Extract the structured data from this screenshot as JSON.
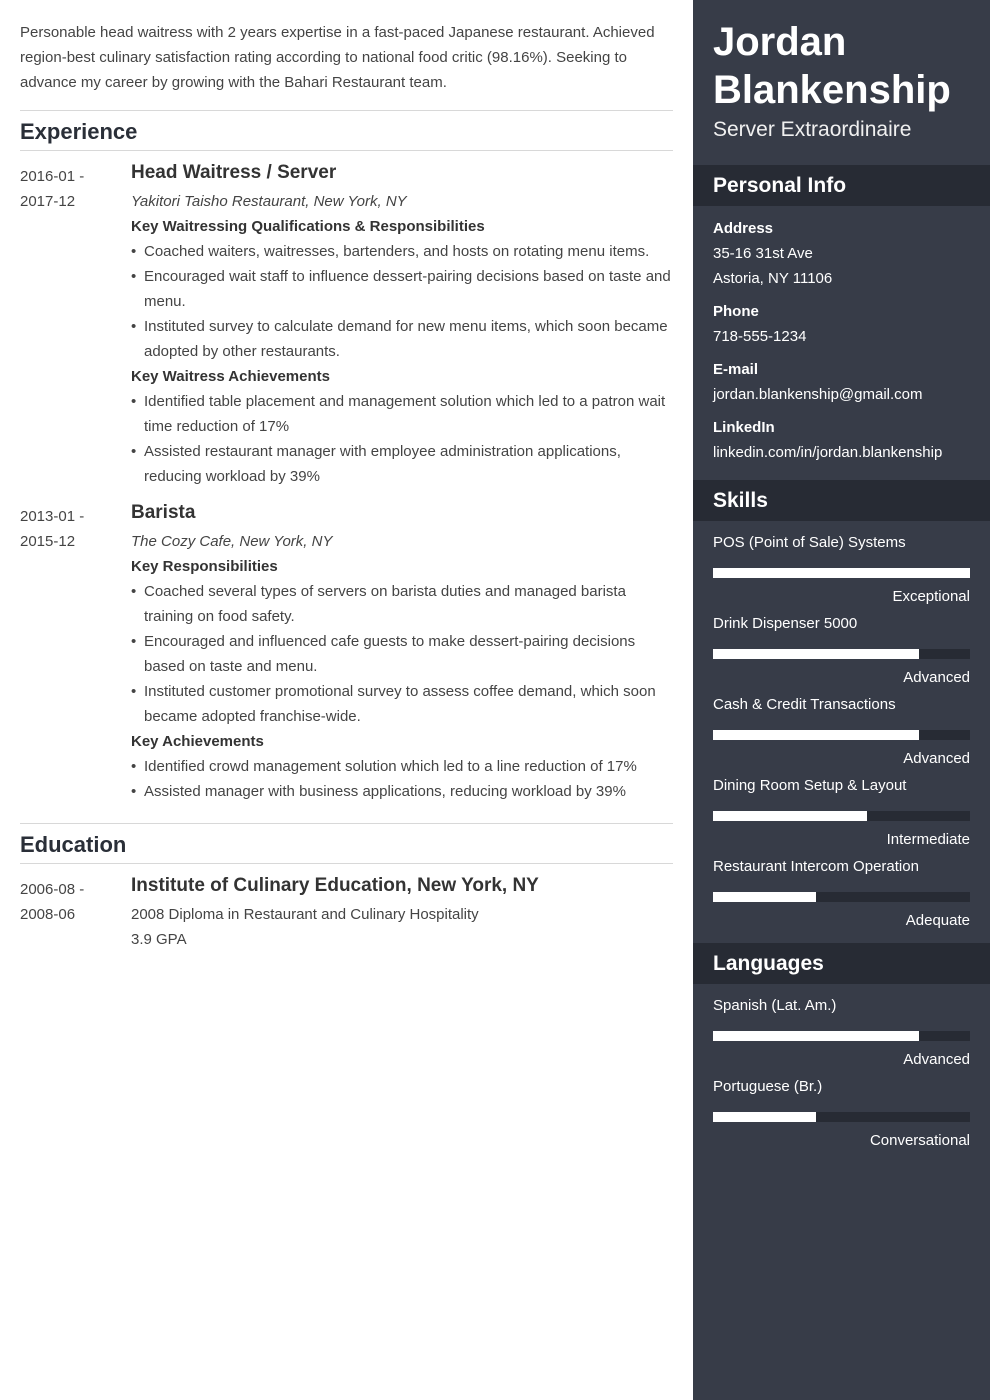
{
  "summary": "Personable head waitress with 2 years expertise in a fast-paced Japanese restaurant. Achieved region-best culinary satisfaction rating according to national food critic (98.16%). Seeking to advance my career by growing with the Bahari Restaurant team.",
  "sections": {
    "experience": "Experience",
    "education": "Education"
  },
  "experience": [
    {
      "date_start": "2016-01 -",
      "date_end": "2017-12",
      "title": "Head Waitress / Server",
      "company": "Yakitori Taisho Restaurant, New York, NY",
      "groups": [
        {
          "heading": "Key Waitressing Qualifications & Responsibilities",
          "bullets": [
            "Coached waiters, waitresses, bartenders, and hosts on rotating menu items.",
            "Encouraged wait staff to influence dessert-pairing decisions based on taste and menu.",
            "Instituted survey to calculate demand for new menu items, which soon became adopted by other restaurants."
          ]
        },
        {
          "heading": "Key Waitress Achievements",
          "bullets": [
            "Identified table placement and management solution which led to a patron wait time reduction of 17%",
            "Assisted restaurant manager with employee administration applications, reducing workload by 39%"
          ]
        }
      ]
    },
    {
      "date_start": "2013-01 -",
      "date_end": "2015-12",
      "title": "Barista",
      "company": "The Cozy Cafe, New York, NY",
      "groups": [
        {
          "heading": "Key Responsibilities",
          "bullets": [
            "Coached several types of servers on barista duties and managed barista training on food safety.",
            "Encouraged and influenced cafe guests to make dessert-pairing decisions based on taste and menu.",
            "Instituted customer promotional survey to assess coffee demand, which soon became adopted franchise-wide."
          ]
        },
        {
          "heading": "Key Achievements",
          "bullets": [
            "Identified crowd management solution which led to a line reduction of 17%",
            "Assisted manager with business applications, reducing workload by 39%"
          ]
        }
      ]
    }
  ],
  "education": {
    "date_start": "2006-08 -",
    "date_end": "2008-06",
    "school": "Institute of Culinary Education, New York, NY",
    "degree": "2008 Diploma in Restaurant and Culinary Hospitality",
    "gpa": "3.9 GPA"
  },
  "sidebar": {
    "first_name": "Jordan",
    "last_name": "Blankenship",
    "role": "Server Extraordinaire",
    "personal_info_title": "Personal Info",
    "address_label": "Address",
    "address_line1": "35-16 31st Ave",
    "address_line2": "Astoria, NY 11106",
    "phone_label": "Phone",
    "phone": "718-555-1234",
    "email_label": "E-mail",
    "email": "jordan.blankenship@gmail.com",
    "linkedin_label": "LinkedIn",
    "linkedin": "linkedin.com/in/jordan.blankenship",
    "skills_title": "Skills",
    "skills": [
      {
        "name": "POS (Point of Sale) Systems",
        "level": "Exceptional",
        "fraction": 1.0
      },
      {
        "name": "Drink Dispenser 5000",
        "level": "Advanced",
        "fraction": 0.8
      },
      {
        "name": "Cash & Credit Transactions",
        "level": "Advanced",
        "fraction": 0.8
      },
      {
        "name": "Dining Room Setup & Layout",
        "level": "Intermediate",
        "fraction": 0.6
      },
      {
        "name": "Restaurant Intercom Operation",
        "level": "Adequate",
        "fraction": 0.4
      }
    ],
    "languages_title": "Languages",
    "languages": [
      {
        "name": "Spanish (Lat. Am.)",
        "level": "Advanced",
        "fraction": 0.8
      },
      {
        "name": "Portuguese (Br.)",
        "level": "Conversational",
        "fraction": 0.4
      }
    ]
  }
}
